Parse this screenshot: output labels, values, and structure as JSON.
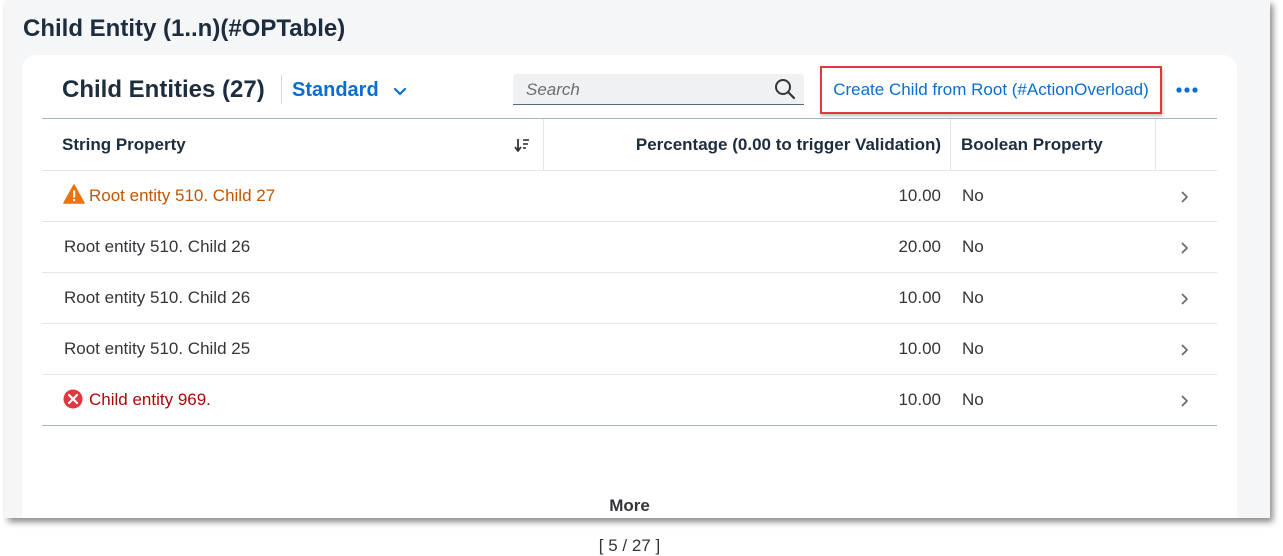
{
  "section": {
    "title": "Child Entity (1..n)(#OPTable)"
  },
  "table": {
    "title": "Child Entities (27)",
    "variant": "Standard",
    "search": {
      "placeholder": "Search",
      "value": ""
    },
    "action_label": "Create Child from Root (#ActionOverload)",
    "columns": [
      {
        "label": "String Property"
      },
      {
        "label": "Percentage (0.00 to trigger Validation)"
      },
      {
        "label": "Boolean Property"
      }
    ],
    "rows": [
      {
        "string": "Root entity 510. Child 27",
        "percentage": "10.00",
        "boolean": "No",
        "status": "warning"
      },
      {
        "string": "Root entity 510. Child 26",
        "percentage": "20.00",
        "boolean": "No",
        "status": "none"
      },
      {
        "string": "Root entity 510. Child 26",
        "percentage": "10.00",
        "boolean": "No",
        "status": "none"
      },
      {
        "string": "Root entity 510. Child 25",
        "percentage": "10.00",
        "boolean": "No",
        "status": "none"
      },
      {
        "string": "Child entity 969.",
        "percentage": "10.00",
        "boolean": "No",
        "status": "error"
      }
    ],
    "more_label": "More",
    "count_label": "[ 5 / 27 ]"
  },
  "colors": {
    "accent": "#0a6ed1",
    "warning": "#e9730c",
    "warning_text": "#c35500",
    "error": "#e0383e",
    "error_text": "#aa0808",
    "highlight_border": "#e0383e"
  },
  "icons": [
    "chevron-down-icon",
    "search-icon",
    "overflow-icon",
    "sort-icon",
    "warning-icon",
    "error-icon",
    "chevron-right-icon"
  ]
}
